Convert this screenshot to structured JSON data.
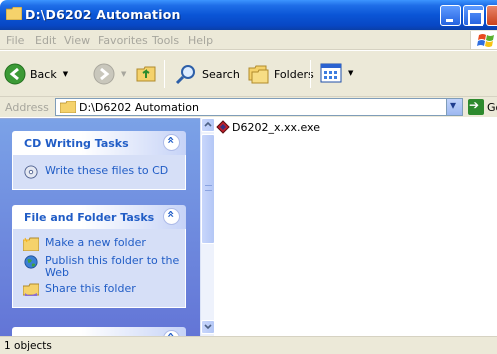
{
  "window": {
    "title": "D:\\D6202 Automation"
  },
  "menu": [
    "File",
    "Edit",
    "View",
    "Favorites",
    "Tools",
    "Help"
  ],
  "toolbar": {
    "back_label": "Back",
    "search_label": "Search",
    "folders_label": "Folders"
  },
  "address": {
    "label": "Address",
    "value": "D:\\D6202 Automation",
    "go_label": "Go"
  },
  "taskpane": {
    "cd_writing": {
      "title": "CD Writing Tasks",
      "items": [
        "Write these files to CD"
      ]
    },
    "file_folder": {
      "title": "File and Folder Tasks",
      "items": [
        "Make a new folder",
        "Publish this folder to the Web",
        "Share this folder"
      ]
    }
  },
  "files": [
    {
      "name": "D6202_x.xx.exe",
      "icon": "exe-icon"
    }
  ],
  "status": {
    "text": "1 objects"
  },
  "colors": {
    "title_blue": "#0a55d6",
    "task_link": "#215dc6",
    "pane_bg": "#6f8ddd"
  }
}
